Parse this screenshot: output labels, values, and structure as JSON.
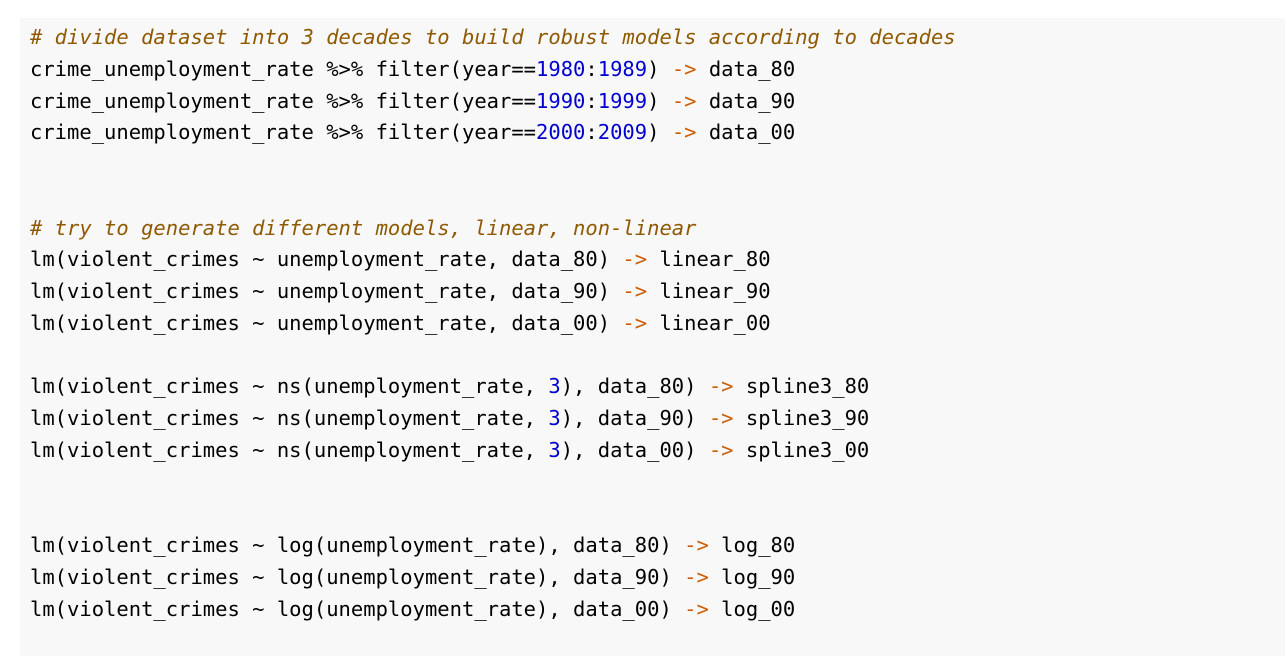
{
  "colors": {
    "background": "#f8f8f8",
    "comment": "#8f5902",
    "number": "#0000cf",
    "operator": "#ce5c00",
    "text": "#000000"
  },
  "code_lines": [
    [
      {
        "t": "comment",
        "v": "# divide dataset into 3 decades to build robust models according to decades"
      }
    ],
    [
      {
        "t": "plain",
        "v": "crime_unemployment_rate %>% filter(year=="
      },
      {
        "t": "num",
        "v": "1980"
      },
      {
        "t": "plain",
        "v": ":"
      },
      {
        "t": "num",
        "v": "1989"
      },
      {
        "t": "plain",
        "v": ") "
      },
      {
        "t": "op",
        "v": "->"
      },
      {
        "t": "plain",
        "v": " data_80"
      }
    ],
    [
      {
        "t": "plain",
        "v": "crime_unemployment_rate %>% filter(year=="
      },
      {
        "t": "num",
        "v": "1990"
      },
      {
        "t": "plain",
        "v": ":"
      },
      {
        "t": "num",
        "v": "1999"
      },
      {
        "t": "plain",
        "v": ") "
      },
      {
        "t": "op",
        "v": "->"
      },
      {
        "t": "plain",
        "v": " data_90"
      }
    ],
    [
      {
        "t": "plain",
        "v": "crime_unemployment_rate %>% filter(year=="
      },
      {
        "t": "num",
        "v": "2000"
      },
      {
        "t": "plain",
        "v": ":"
      },
      {
        "t": "num",
        "v": "2009"
      },
      {
        "t": "plain",
        "v": ") "
      },
      {
        "t": "op",
        "v": "->"
      },
      {
        "t": "plain",
        "v": " data_00"
      }
    ],
    [],
    [],
    [
      {
        "t": "comment",
        "v": "# try to generate different models, linear, non-linear"
      }
    ],
    [
      {
        "t": "plain",
        "v": "lm(violent_crimes ~ unemployment_rate, data_80) "
      },
      {
        "t": "op",
        "v": "->"
      },
      {
        "t": "plain",
        "v": " linear_80"
      }
    ],
    [
      {
        "t": "plain",
        "v": "lm(violent_crimes ~ unemployment_rate, data_90) "
      },
      {
        "t": "op",
        "v": "->"
      },
      {
        "t": "plain",
        "v": " linear_90"
      }
    ],
    [
      {
        "t": "plain",
        "v": "lm(violent_crimes ~ unemployment_rate, data_00) "
      },
      {
        "t": "op",
        "v": "->"
      },
      {
        "t": "plain",
        "v": " linear_00"
      }
    ],
    [],
    [
      {
        "t": "plain",
        "v": "lm(violent_crimes ~ ns(unemployment_rate, "
      },
      {
        "t": "num",
        "v": "3"
      },
      {
        "t": "plain",
        "v": "), data_80) "
      },
      {
        "t": "op",
        "v": "->"
      },
      {
        "t": "plain",
        "v": " spline3_80"
      }
    ],
    [
      {
        "t": "plain",
        "v": "lm(violent_crimes ~ ns(unemployment_rate, "
      },
      {
        "t": "num",
        "v": "3"
      },
      {
        "t": "plain",
        "v": "), data_90) "
      },
      {
        "t": "op",
        "v": "->"
      },
      {
        "t": "plain",
        "v": " spline3_90"
      }
    ],
    [
      {
        "t": "plain",
        "v": "lm(violent_crimes ~ ns(unemployment_rate, "
      },
      {
        "t": "num",
        "v": "3"
      },
      {
        "t": "plain",
        "v": "), data_00) "
      },
      {
        "t": "op",
        "v": "->"
      },
      {
        "t": "plain",
        "v": " spline3_00"
      }
    ],
    [],
    [],
    [
      {
        "t": "plain",
        "v": "lm(violent_crimes ~ log(unemployment_rate), data_80) "
      },
      {
        "t": "op",
        "v": "->"
      },
      {
        "t": "plain",
        "v": " log_80"
      }
    ],
    [
      {
        "t": "plain",
        "v": "lm(violent_crimes ~ log(unemployment_rate), data_90) "
      },
      {
        "t": "op",
        "v": "->"
      },
      {
        "t": "plain",
        "v": " log_90"
      }
    ],
    [
      {
        "t": "plain",
        "v": "lm(violent_crimes ~ log(unemployment_rate), data_00) "
      },
      {
        "t": "op",
        "v": "->"
      },
      {
        "t": "plain",
        "v": " log_00"
      }
    ]
  ]
}
